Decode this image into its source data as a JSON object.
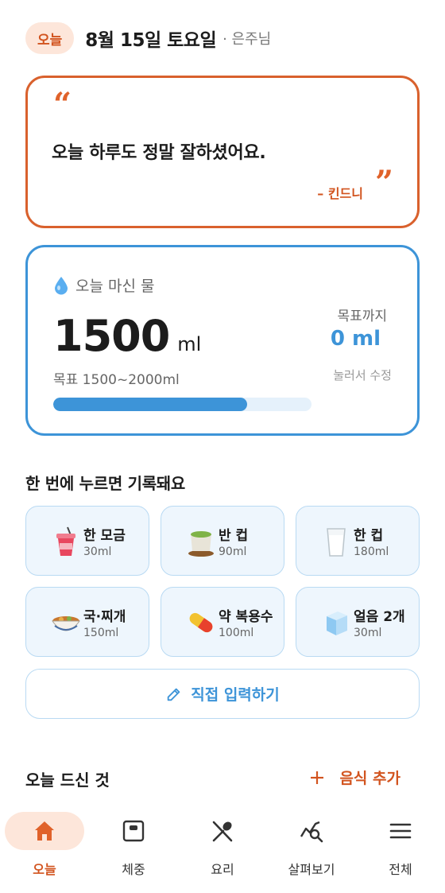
{
  "header": {
    "today_badge": "오늘",
    "date": "8월 15일 토요일",
    "user": "· 은주님"
  },
  "quote": {
    "open_mark": "“",
    "text": "오늘 하루도 정말 잘하셨어요.",
    "author": "– 킨드니",
    "close_mark": "”"
  },
  "water": {
    "title": "오늘 마신 물",
    "amount": "1500",
    "unit": "ml",
    "goal": "목표 1500~2000ml",
    "progress_fraction": 0.75,
    "remaining_label": "목표까지",
    "remaining_value": "0 ml",
    "edit_hint": "눌러서 수정"
  },
  "quick": {
    "title": "한 번에 누르면 기록돼요",
    "items": [
      {
        "label": "한 모금",
        "amount": "30ml",
        "icon": "soda-cup-icon"
      },
      {
        "label": "반 컵",
        "amount": "90ml",
        "icon": "tea-cup-icon"
      },
      {
        "label": "한 컵",
        "amount": "180ml",
        "icon": "milk-glass-icon"
      },
      {
        "label": "국·찌개",
        "amount": "150ml",
        "icon": "soup-bowl-icon"
      },
      {
        "label": "약 복용수",
        "amount": "100ml",
        "icon": "pill-icon"
      },
      {
        "label": "얼음 2개",
        "amount": "30ml",
        "icon": "ice-cube-icon"
      }
    ],
    "manual_label": "직접 입력하기"
  },
  "food": {
    "title": "오늘 드신 것",
    "add_label": "음식 추가"
  },
  "nav": {
    "items": [
      {
        "label": "오늘",
        "icon": "home-icon"
      },
      {
        "label": "체중",
        "icon": "scale-icon"
      },
      {
        "label": "요리",
        "icon": "utensils-icon"
      },
      {
        "label": "살펴보기",
        "icon": "chart-search-icon"
      },
      {
        "label": "전체",
        "icon": "menu-icon"
      }
    ]
  },
  "colors": {
    "accent_orange": "#d9612d",
    "accent_blue": "#3d94d8",
    "badge_bg": "#fde6da",
    "tile_bg": "#eef6fd"
  }
}
